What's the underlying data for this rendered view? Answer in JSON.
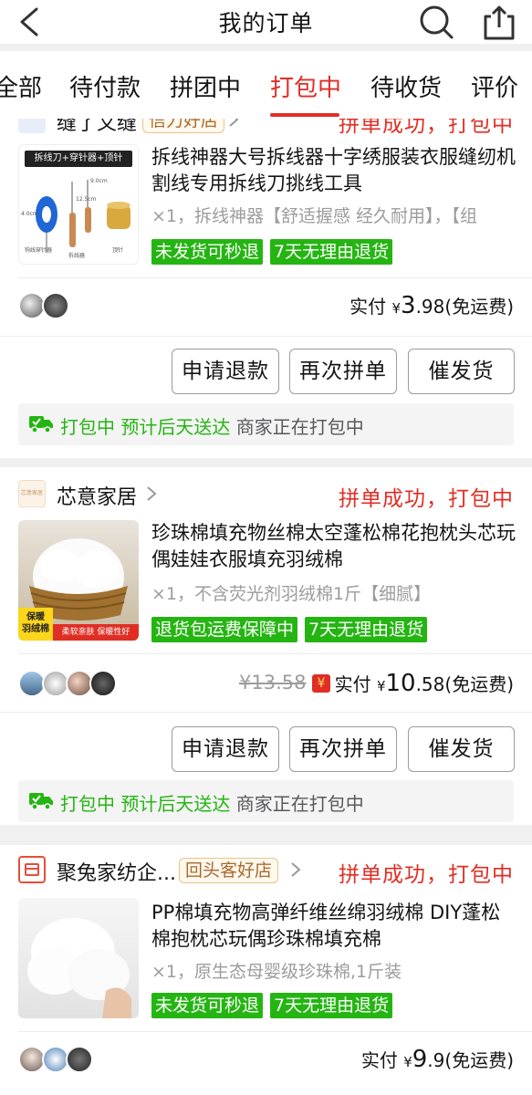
{
  "header": {
    "title": "我的订单"
  },
  "tabs": [
    "全部",
    "待付款",
    "拼团中",
    "打包中",
    "待收货",
    "评价"
  ],
  "active_tab": "打包中",
  "colors": {
    "accent": "#e02e24",
    "tag_green": "#25b513"
  },
  "orders": [
    {
      "shop_name": "缝了又缝",
      "shop_badge": "信力好店",
      "status": "拼单成功，打包中",
      "product_title": "拆线神器大号拆线器十字绣服装衣服缝纫机割线专用拆线刀挑线工具",
      "spec": "×1，拆线神器【舒适握感 经久耐用】，【组",
      "thumb_caption": "拆线刀+穿针器+顶针",
      "thumb_labels": [
        "钩线穿针器",
        "拆线器",
        "顶针",
        "4.0cm",
        "12.5cm",
        "9.0cm"
      ],
      "tags": [
        "未发货可秒退",
        "7天无理由退货"
      ],
      "paid_label": "实付",
      "currency": "¥",
      "price_int": "3",
      "price_dec": ".98",
      "shipping": "(免运费)",
      "buttons": [
        "申请退款",
        "再次拼单",
        "催发货"
      ],
      "notice_green": "打包中 预计后天送达",
      "notice_gray": "商家正在打包中"
    },
    {
      "shop_name": "芯意家居",
      "shop_logo_text": "芯意家居",
      "status": "拼单成功，打包中",
      "product_title": "珍珠棉填充物丝棉太空蓬松棉花抱枕头芯玩偶娃娃衣服填充羽绒棉",
      "spec": "×1，不含荧光剂羽绒棉1斤【细腻】",
      "thumb_badge": "保暖\n羽绒棉",
      "thumb_banner": "柔软亲肤 保暖性好",
      "tags": [
        "退货包运费保障中",
        "7天无理由退货"
      ],
      "orig_price": "¥13.58",
      "paid_label": "实付",
      "currency": "¥",
      "price_int": "10",
      "price_dec": ".58",
      "shipping": "(免运费)",
      "buttons": [
        "申请退款",
        "再次拼单",
        "催发货"
      ],
      "notice_green": "打包中 预计后天送达",
      "notice_gray": "商家正在打包中"
    },
    {
      "shop_name": "聚兔家纺企...",
      "shop_badge": "回头客好店",
      "status": "拼单成功，打包中",
      "product_title": "PP棉填充物高弹纤维丝绵羽绒棉 DIY蓬松棉抱枕芯玩偶珍珠棉填充棉",
      "spec": "×1，原生态母婴级珍珠棉,1斤装",
      "tags": [
        "未发货可秒退",
        "7天无理由退货"
      ],
      "paid_label": "实付",
      "currency": "¥",
      "price_int": "9",
      "price_dec": ".9",
      "shipping": "(免运费)"
    }
  ]
}
